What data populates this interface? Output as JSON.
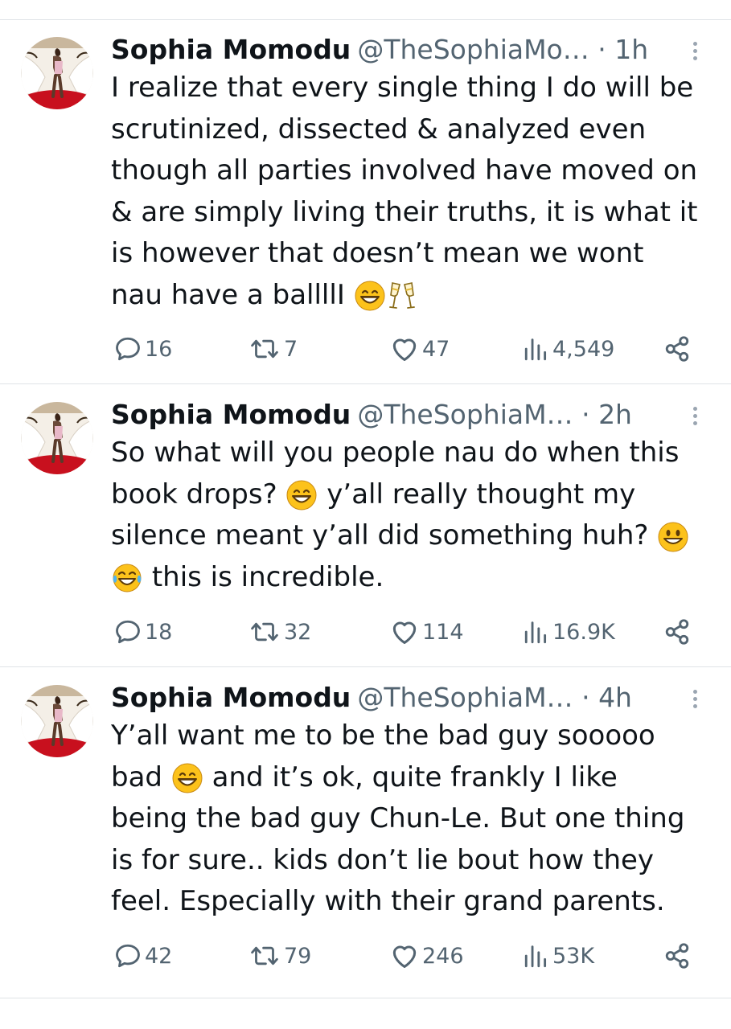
{
  "colors": {
    "text": "#0f1419",
    "secondary": "#536471",
    "divider": "#dfe3e7"
  },
  "tweets": [
    {
      "name": "Sophia Momodu",
      "handle": "@TheSophiaMo…",
      "separator": "·",
      "time": "1h",
      "lines": [
        "I realize that every single thing I do will be",
        "scrutinized, dissected & analyzed even",
        "though all parties involved have moved on",
        "& are simply living their truths, it is what it",
        "is however that doesn’t mean we wont",
        "nau have a ballllI"
      ],
      "replies": "16",
      "retweets": "7",
      "likes": "47",
      "views": "4,549"
    },
    {
      "name": "Sophia Momodu",
      "handle": "@TheSophiaM…",
      "separator": "·",
      "time": "2h",
      "lines": [
        "So what will you people nau do when this",
        "book drops?",
        "y’all really thought my",
        "silence meant y’all did something huh?",
        "this is incredible."
      ],
      "replies": "18",
      "retweets": "32",
      "likes": "114",
      "views": "16.9K"
    },
    {
      "name": "Sophia Momodu",
      "handle": "@TheSophiaM…",
      "separator": "·",
      "time": "4h",
      "lines": [
        "Y’all want me to be the bad guy sooooo",
        "bad",
        "and it’s ok, quite frankly I like",
        "being the bad guy Chun-Le. But one thing",
        "is for sure.. kids don’t lie bout how they",
        "feel. Especially with their grand parents."
      ],
      "replies": "42",
      "retweets": "79",
      "likes": "246",
      "views": "53K"
    }
  ]
}
